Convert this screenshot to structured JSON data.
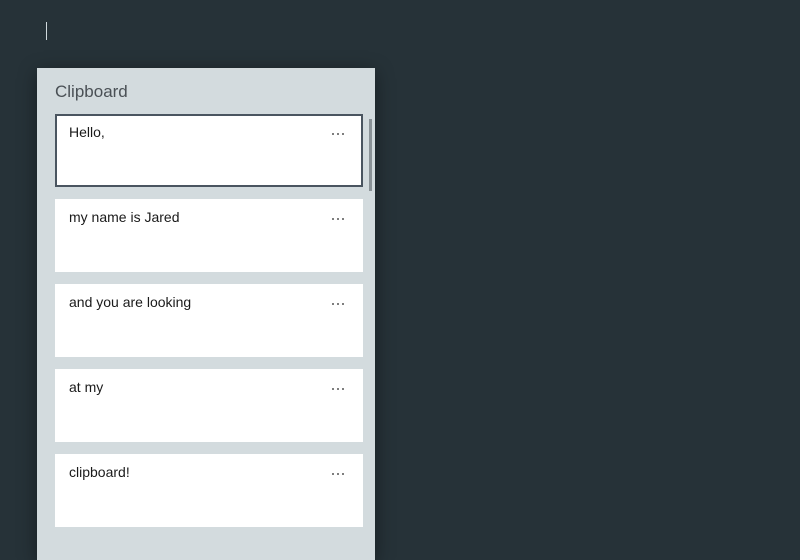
{
  "clipboard": {
    "title": "Clipboard",
    "items": [
      {
        "text": "Hello,",
        "selected": true
      },
      {
        "text": "my name is Jared",
        "selected": false
      },
      {
        "text": "and you are looking",
        "selected": false
      },
      {
        "text": "at my",
        "selected": false
      },
      {
        "text": "clipboard!",
        "selected": false
      }
    ]
  }
}
